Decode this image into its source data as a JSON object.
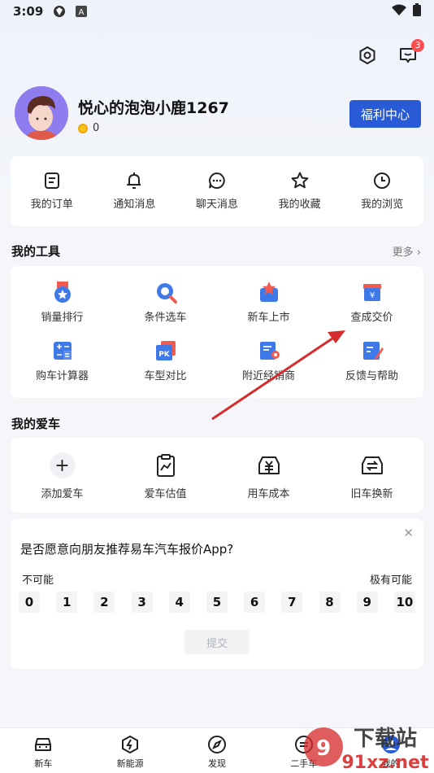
{
  "status_bar": {
    "time": "3:09"
  },
  "header": {
    "messages_badge": "3"
  },
  "profile": {
    "username": "悦心的泡泡小鹿1267",
    "coins": "0",
    "welfare_button": "福利中心"
  },
  "quick_links": [
    {
      "label": "我的订单",
      "icon": "order-icon"
    },
    {
      "label": "通知消息",
      "icon": "bell-icon"
    },
    {
      "label": "聊天消息",
      "icon": "chat-icon"
    },
    {
      "label": "我的收藏",
      "icon": "star-icon"
    },
    {
      "label": "我的浏览",
      "icon": "clock-icon"
    }
  ],
  "tools": {
    "title": "我的工具",
    "more": "更多",
    "items": [
      {
        "label": "销量排行",
        "icon": "medal-icon"
      },
      {
        "label": "条件选车",
        "icon": "search-car-icon"
      },
      {
        "label": "新车上市",
        "icon": "new-car-icon"
      },
      {
        "label": "查成交价",
        "icon": "price-icon"
      },
      {
        "label": "购车计算器",
        "icon": "calculator-icon"
      },
      {
        "label": "车型对比",
        "icon": "pk-icon"
      },
      {
        "label": "附近经销商",
        "icon": "dealer-icon"
      },
      {
        "label": "反馈与帮助",
        "icon": "feedback-icon"
      }
    ]
  },
  "my_car": {
    "title": "我的爱车",
    "items": [
      {
        "label": "添加爱车",
        "icon": "plus-icon"
      },
      {
        "label": "爱车估值",
        "icon": "valuation-icon"
      },
      {
        "label": "用车成本",
        "icon": "cost-icon"
      },
      {
        "label": "旧车换新",
        "icon": "trade-in-icon"
      }
    ]
  },
  "survey": {
    "question": "是否愿意向朋友推荐易车汽车报价App?",
    "low_label": "不可能",
    "high_label": "极有可能",
    "scale": [
      "0",
      "1",
      "2",
      "3",
      "4",
      "5",
      "6",
      "7",
      "8",
      "9",
      "10"
    ],
    "submit": "提交"
  },
  "tabbar": [
    {
      "label": "新车",
      "icon": "car-icon"
    },
    {
      "label": "新能源",
      "icon": "energy-icon"
    },
    {
      "label": "发现",
      "icon": "compass-icon"
    },
    {
      "label": "二手车",
      "icon": "used-car-icon"
    },
    {
      "label": "我的",
      "icon": "user-icon"
    }
  ],
  "watermark": {
    "brand": "下载站",
    "domain": "91xz.net"
  },
  "colors": {
    "accent": "#2a5bd7",
    "badge": "#ff4d4f",
    "arrow": "#d62c2c"
  }
}
